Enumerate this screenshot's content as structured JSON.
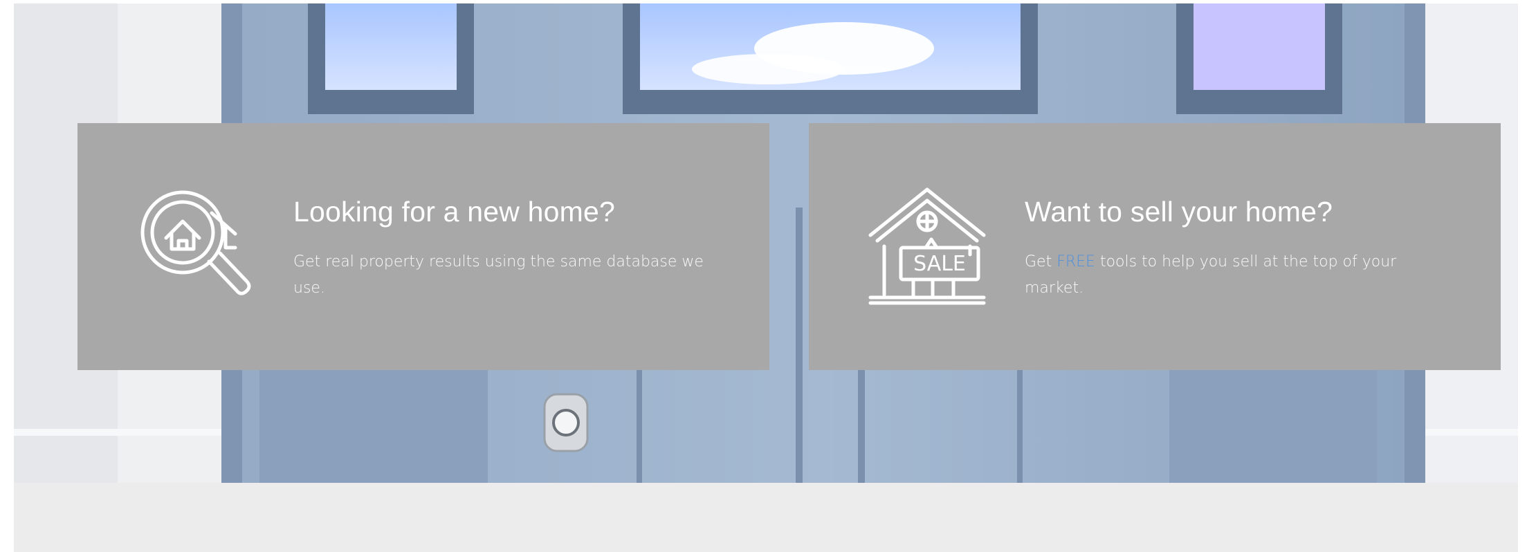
{
  "cards": [
    {
      "title": "Looking for a new home?",
      "description": "Get real property results using the same database we use.",
      "icon": "house-search-icon"
    },
    {
      "title": "Want to sell your home?",
      "description_prefix": "Get ",
      "description_highlight": "FREE",
      "description_suffix": " tools to help you sell at the top of your market.",
      "icon": "house-sale-sign-icon",
      "sign_text": "SALE"
    }
  ],
  "colors": {
    "card_background": "#a8a8a8",
    "card_text": "#ffffff",
    "highlight": "#4a8fe0",
    "page_background": "#ececec"
  }
}
